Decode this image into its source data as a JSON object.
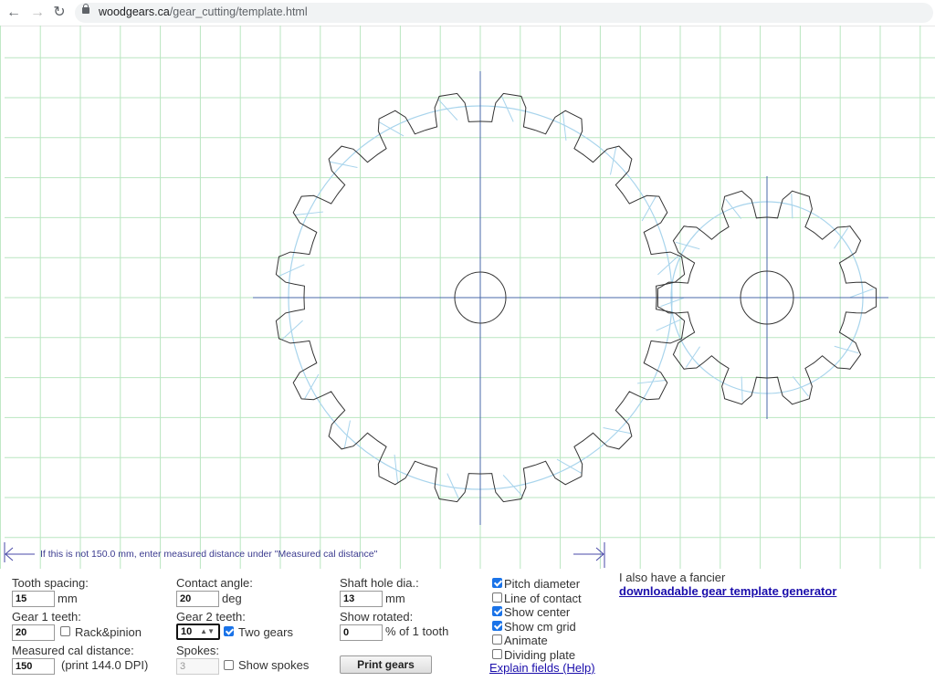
{
  "browser": {
    "url_host": "woodgears.ca",
    "url_path": "/gear_cutting/template.html",
    "back_icon": "arrow-left",
    "forward_icon": "arrow-right",
    "reload_icon": "reload",
    "lock_icon": "lock"
  },
  "drawing": {
    "calibration_note": "If this is not 150.0 mm, enter measured distance under \"Measured cal distance\"",
    "colors": {
      "grid": "#b9e6c0",
      "gear_outline": "#333333",
      "pitch_circle": "#a8d4ec",
      "center_lines": "#4a6aa8",
      "cal_arrow": "#4a4aa8"
    },
    "gear1": {
      "teeth": 20
    },
    "gear2": {
      "teeth": 10
    }
  },
  "form": {
    "tooth_spacing": {
      "label": "Tooth spacing:",
      "value": "15",
      "unit": "mm"
    },
    "gear1_teeth": {
      "label": "Gear 1 teeth:",
      "value": "20"
    },
    "rack_pinion": {
      "label": "Rack&pinion",
      "checked": false
    },
    "measured_cal": {
      "label": "Measured cal distance:",
      "value": "150",
      "note": "(print 144.0 DPI)"
    },
    "contact_angle": {
      "label": "Contact angle:",
      "value": "20",
      "unit": "deg"
    },
    "gear2_teeth": {
      "label": "Gear 2 teeth:",
      "value": "10",
      "spin_icon": "spinner-arrows"
    },
    "two_gears": {
      "label": "Two gears",
      "checked": true
    },
    "spokes": {
      "label": "Spokes:",
      "value": "3"
    },
    "show_spokes": {
      "label": "Show spokes",
      "checked": false
    },
    "shaft_hole": {
      "label": "Shaft hole dia.:",
      "value": "13",
      "unit": "mm"
    },
    "show_rotated": {
      "label": "Show rotated:",
      "value": "0",
      "unit": "% of 1 tooth"
    },
    "print_button": "Print gears",
    "options": [
      {
        "label": "Pitch diameter",
        "checked": true
      },
      {
        "label": "Line of contact",
        "checked": false
      },
      {
        "label": "Show center",
        "checked": true
      },
      {
        "label": "Show cm grid",
        "checked": true
      },
      {
        "label": "Animate",
        "checked": false
      },
      {
        "label": "Dividing plate",
        "checked": false
      }
    ],
    "help_link": "Explain fields (Help)",
    "fancier_text": "I also have a fancier",
    "fancier_link": "downloadable gear template generator"
  }
}
